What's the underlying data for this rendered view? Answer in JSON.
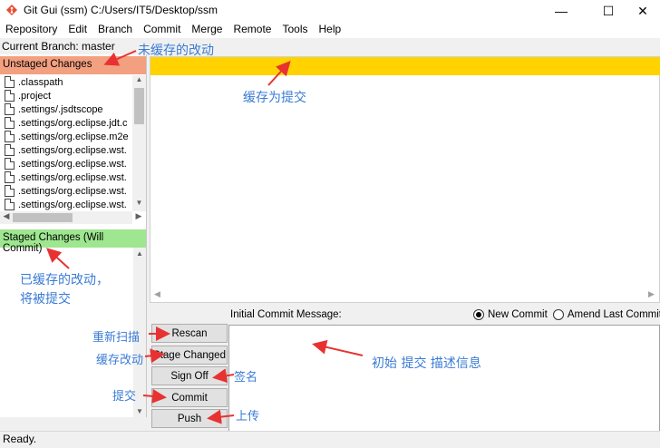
{
  "window": {
    "title": "Git Gui (ssm) C:/Users/IT5/Desktop/ssm",
    "minimize_glyph": "—",
    "maximize_glyph": "☐",
    "close_glyph": "✕"
  },
  "menu": [
    "Repository",
    "Edit",
    "Branch",
    "Commit",
    "Merge",
    "Remote",
    "Tools",
    "Help"
  ],
  "branch_line": "Current Branch: master",
  "unstaged": {
    "header": "Unstaged Changes",
    "files": [
      ".classpath",
      ".project",
      ".settings/.jsdtscope",
      ".settings/org.eclipse.jdt.c",
      ".settings/org.eclipse.m2e",
      ".settings/org.eclipse.wst.",
      ".settings/org.eclipse.wst.",
      ".settings/org.eclipse.wst.",
      ".settings/org.eclipse.wst.",
      ".settings/org.eclipse.wst."
    ]
  },
  "staged": {
    "header": "Staged Changes (Will Commit)"
  },
  "commit": {
    "message_label": "Initial Commit Message:",
    "radio_new": "New Commit",
    "radio_amend": "Amend Last Commit",
    "buttons": {
      "rescan": "Rescan",
      "stage_changed": "Stage Changed",
      "sign_off": "Sign Off",
      "commit": "Commit",
      "push": "Push"
    }
  },
  "status": "Ready.",
  "annotations": {
    "unstaged": "未缓存的改动",
    "diff": "缓存为提交",
    "staged_line1": "已缓存的改动，",
    "staged_line2": "将被提交",
    "rescan": "重新扫描",
    "stage_changed": "缓存改动",
    "sign_off": "签名",
    "commit": "提交",
    "push": "上传",
    "message": "初始 提交 描述信息"
  },
  "colors": {
    "unstaged_header": "#f3a080",
    "staged_header": "#9ee68f",
    "diff_header": "#ffd200",
    "annotation_text": "#3a7bd5",
    "annotation_arrow": "#e83232"
  }
}
